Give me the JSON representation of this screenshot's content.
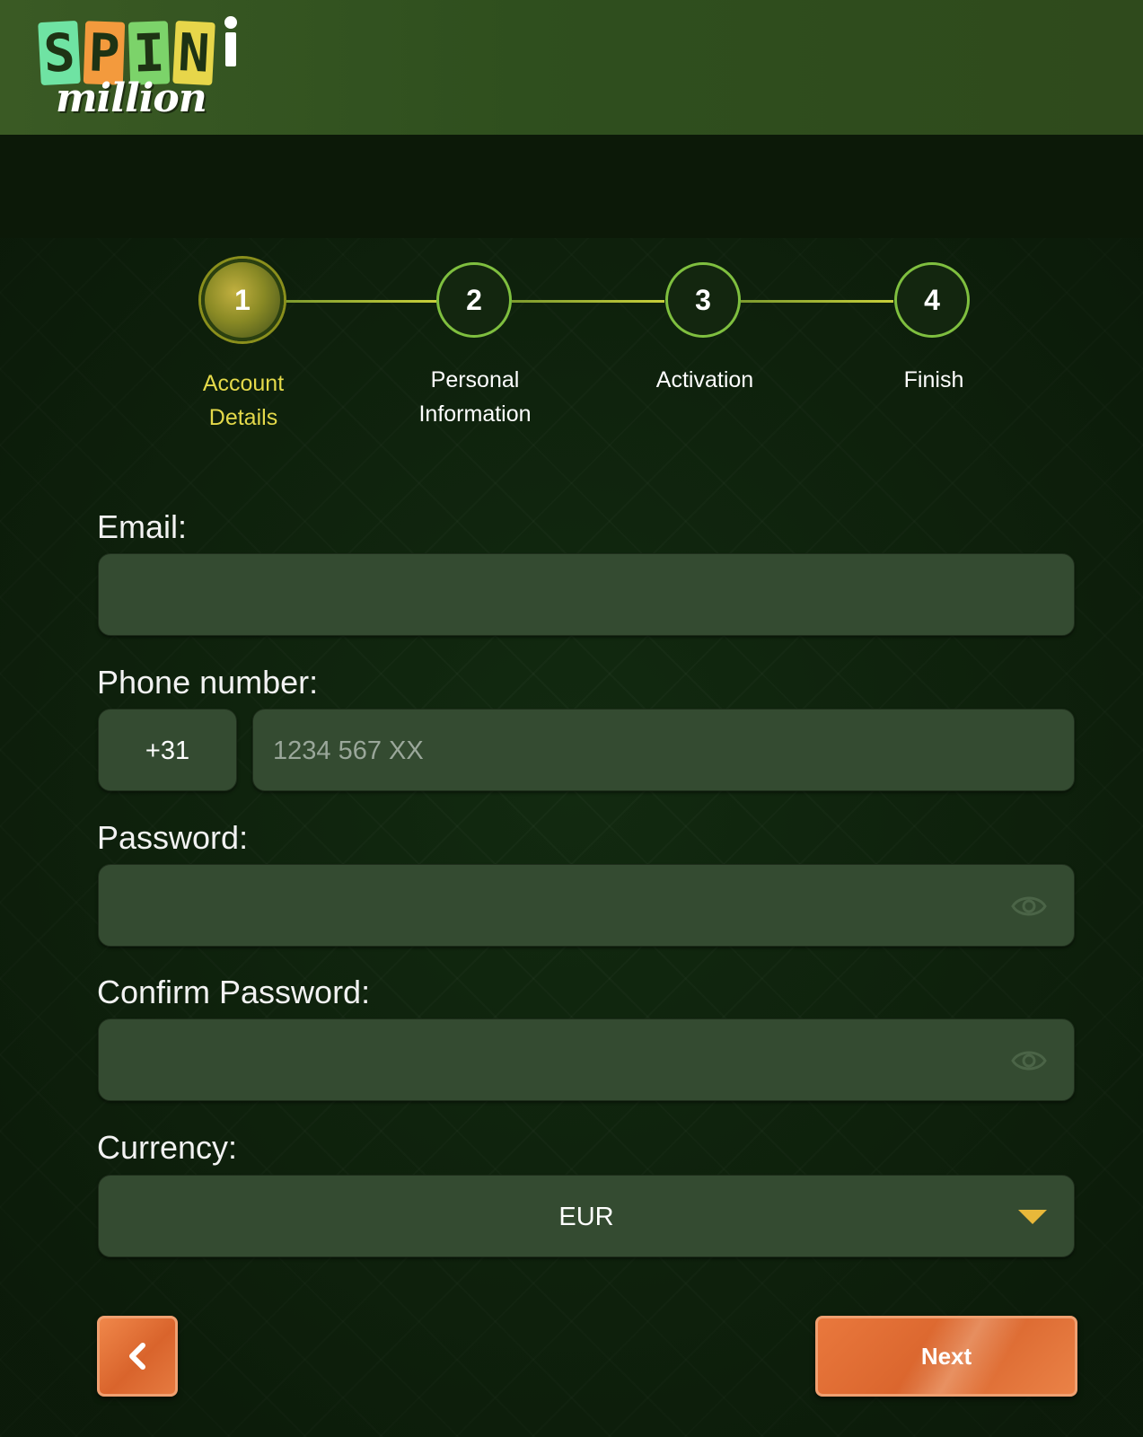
{
  "brand": {
    "logo_letters": [
      "S",
      "P",
      "I",
      "N"
    ],
    "logo_word": "million",
    "colors": {
      "letter_s": "#6fe3a3",
      "letter_p": "#f39a3d",
      "letter_i": "#7cd36a",
      "letter_n": "#e7d64a"
    }
  },
  "stepper": {
    "steps": [
      {
        "number": "1",
        "label_line1": "Account",
        "label_line2": "Details",
        "active": true
      },
      {
        "number": "2",
        "label_line1": "Personal",
        "label_line2": "Information",
        "active": false
      },
      {
        "number": "3",
        "label_line1": "Activation",
        "label_line2": "",
        "active": false
      },
      {
        "number": "4",
        "label_line1": "Finish",
        "label_line2": "",
        "active": false
      }
    ]
  },
  "form": {
    "email": {
      "label": "Email:",
      "value": ""
    },
    "phone": {
      "label": "Phone number:",
      "country_code": "+31",
      "placeholder": "1234 567 XX",
      "value": ""
    },
    "password": {
      "label": "Password:",
      "value": "",
      "toggle_icon": "eye-icon"
    },
    "confirm_password": {
      "label": "Confirm Password:",
      "value": "",
      "toggle_icon": "eye-icon"
    },
    "currency": {
      "label": "Currency:",
      "selected": "EUR",
      "dropdown_icon": "caret-down-icon"
    }
  },
  "actions": {
    "back_icon": "chevron-left-icon",
    "next_label": "Next",
    "accent_color": "#e2703a"
  }
}
